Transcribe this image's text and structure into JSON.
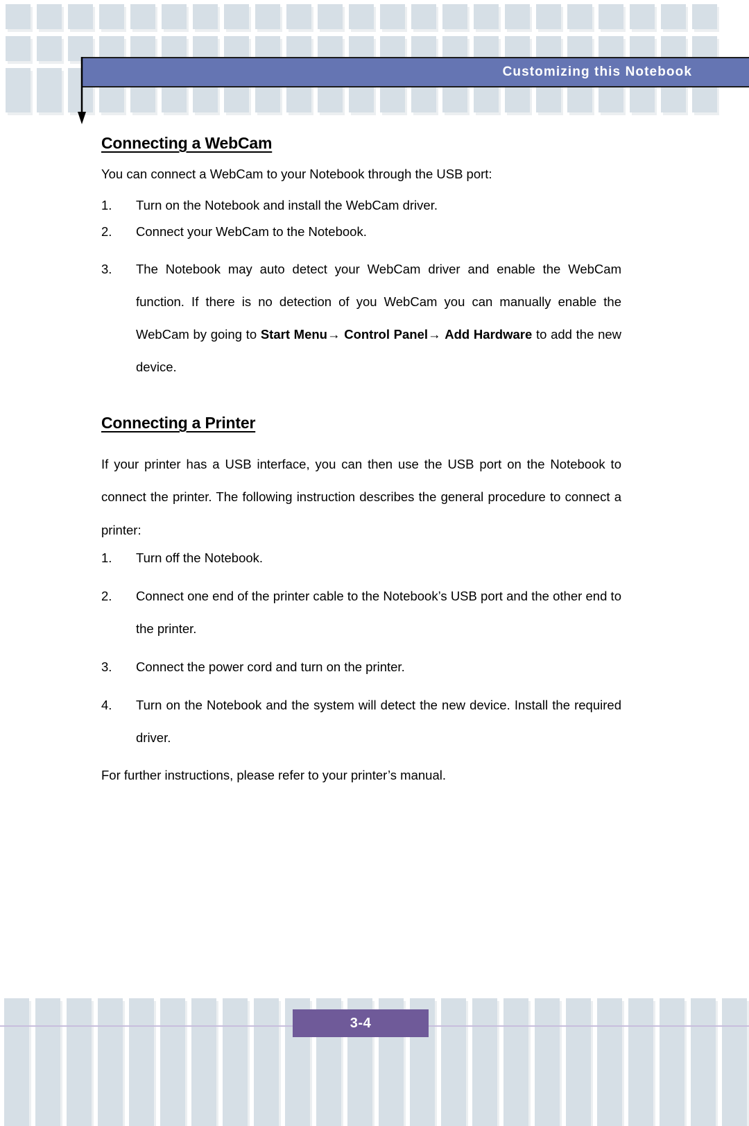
{
  "header": {
    "banner_title": "Customizing this Notebook",
    "banner_color": "#6575b3",
    "arrow_icon": "down-arrow-icon"
  },
  "pattern": {
    "square_color": "#d6dfe6",
    "square_shadow": "#eceff1"
  },
  "content": {
    "sections": [
      {
        "title": "Connecting a WebCam",
        "lead": "You can connect a WebCam to your Notebook through the USB port:",
        "steps": [
          {
            "num": "1.",
            "text": "Turn on the Notebook and install the WebCam driver."
          },
          {
            "num": "2.",
            "text": "Connect your WebCam to the Notebook."
          },
          {
            "num": "3.",
            "text_part_1": "The Notebook may auto detect your WebCam driver and enable the WebCam function.  If there is no detection of you WebCam you can manually enable the WebCam by going to ",
            "bold_1": "Start Menu",
            "arrow_1": "→",
            "text_part_2": " ",
            "bold_2": "Control Panel",
            "arrow_2": "→",
            "bold_3": "Add Hardware",
            "text_part_3": " to add the new device."
          }
        ]
      },
      {
        "title": "Connecting a Printer",
        "lead": "If your printer has a USB interface, you can then use the USB port on the Notebook to connect the printer.  The following instruction describes the general procedure to connect a printer:",
        "steps": [
          {
            "num": "1.",
            "text": "Turn off the Notebook."
          },
          {
            "num": "2.",
            "text": "Connect one end of the printer cable to the Notebook’s USB port and the other end to the printer."
          },
          {
            "num": "3.",
            "text": "Connect the power cord and turn on the printer."
          },
          {
            "num": "4.",
            "text": "Turn on the Notebook and the system will detect the new device.   Install the required driver."
          }
        ],
        "closing": "For further instructions, please refer to your printer’s manual."
      }
    ]
  },
  "footer": {
    "page_number": "3-4",
    "badge_color": "#6f5a99",
    "rule_color": "#c8bedd"
  }
}
